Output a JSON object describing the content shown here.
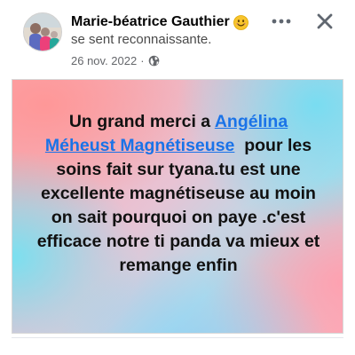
{
  "post": {
    "author": "Marie-béatrice Gauthier",
    "author_emoji": "smiling-face-emoji",
    "feeling": "se sent reconnaissante.",
    "date": "26 nov. 2022",
    "separator": "·",
    "privacy_icon": "globe-icon",
    "more_icon": "more-horizontal-icon",
    "close_icon": "close-icon"
  },
  "card": {
    "text_before": "Un grand merci a ",
    "mention_line1": "Angélina",
    "mention_line2": "Méheust Magnétiseuse",
    "text_after": "  pour les soins fait sur tyana.tu est une excellente magnétiseuse au moin on sait pourquoi on paye .c'est efficace notre ti panda va mieux et remange enfin",
    "mention_color": "#1a73e8",
    "background_colors": [
      "#f9a8b0",
      "#74ddf2",
      "#fbb0bb"
    ]
  }
}
